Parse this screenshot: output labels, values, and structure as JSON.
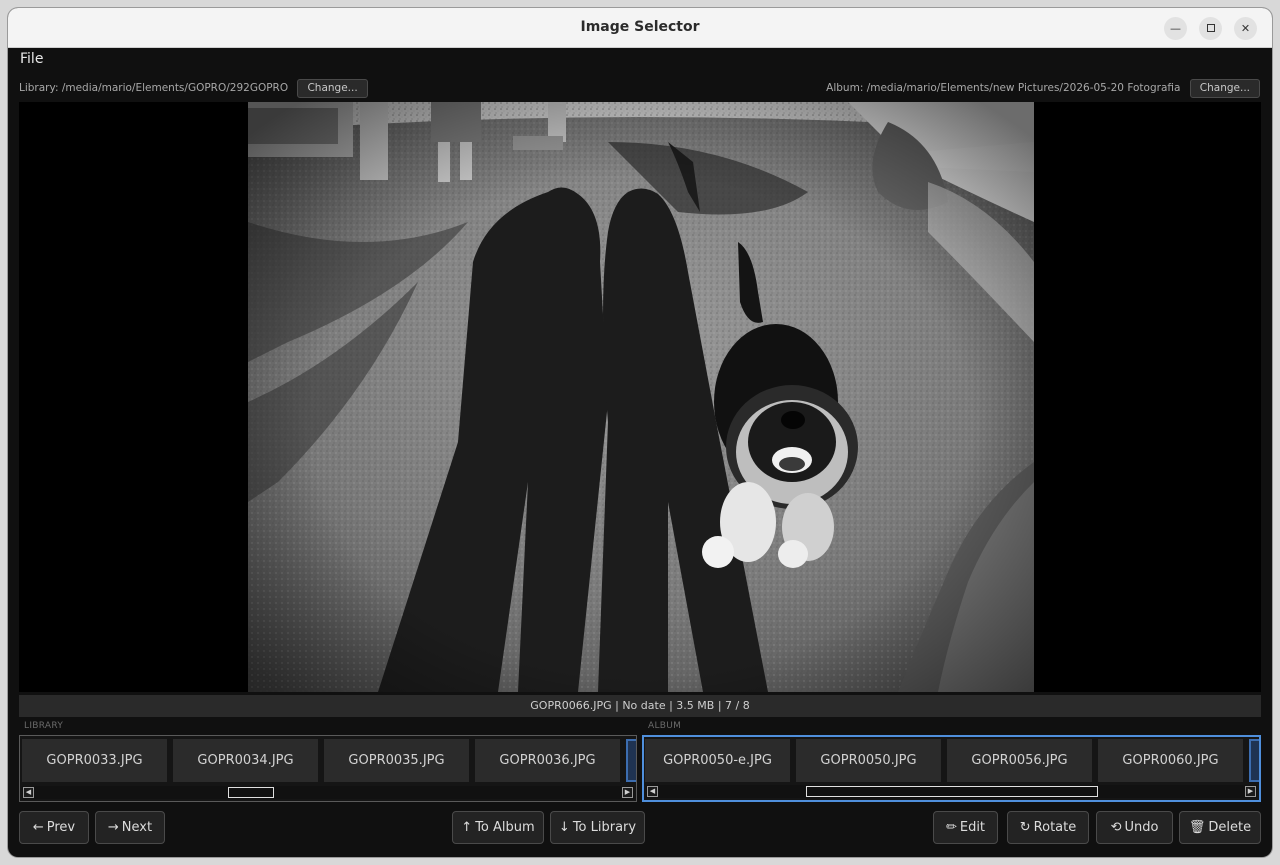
{
  "window": {
    "title": "Image Selector"
  },
  "menu": {
    "file": "File"
  },
  "library": {
    "path_label": "Library: /media/mario/Elements/GOPRO/292GOPRO",
    "change_label": "Change...",
    "section_label": "LIBRARY",
    "thumbnails": [
      "GOPR0033.JPG",
      "GOPR0034.JPG",
      "GOPR0035.JPG",
      "GOPR0036.JPG"
    ]
  },
  "album": {
    "path_label": "Album: /media/mario/Elements/new Pictures/2026-05-20 Fotografia",
    "change_label": "Change...",
    "section_label": "ALBUM",
    "thumbnails": [
      "GOPR0050-e.JPG",
      "GOPR0050.JPG",
      "GOPR0056.JPG",
      "GOPR0060.JPG"
    ]
  },
  "info": {
    "text": "GOPR0066.JPG  |  No date  |  3.5 MB  |  7 / 8"
  },
  "toolbar": {
    "prev": {
      "icon": "←",
      "label": "Prev"
    },
    "next": {
      "icon": "→",
      "label": "Next"
    },
    "to_album": {
      "icon": "↑",
      "label": "To Album"
    },
    "to_library": {
      "icon": "↓",
      "label": "To Library"
    },
    "edit": {
      "icon": "✏",
      "label": "Edit"
    },
    "rotate": {
      "icon": "↻",
      "label": "Rotate"
    },
    "undo": {
      "icon": "⟲",
      "label": "Undo"
    },
    "delete": {
      "icon": "🗑",
      "label": "Delete"
    }
  },
  "colors": {
    "window_bg": "#101010",
    "accent_focus": "#4f8fdc",
    "button_bg": "#232323"
  }
}
